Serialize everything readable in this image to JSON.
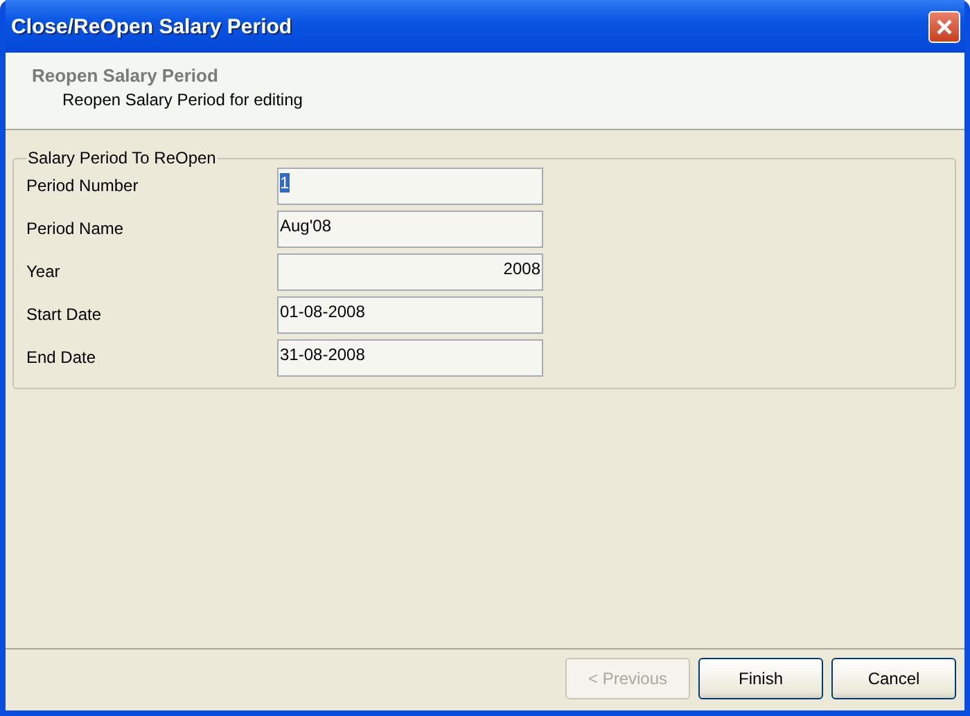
{
  "window": {
    "title": "Close/ReOpen Salary Period"
  },
  "header": {
    "title": "Reopen Salary Period",
    "subtitle": "Reopen Salary Period for editing"
  },
  "group": {
    "title": "Salary Period To ReOpen",
    "fields": [
      {
        "label": "Period Number",
        "value": "1",
        "kind": "text",
        "selected": true
      },
      {
        "label": "Period Name",
        "value": "Aug'08",
        "kind": "text",
        "selected": false
      },
      {
        "label": "Year",
        "value": "2008",
        "kind": "number",
        "selected": false
      },
      {
        "label": "Start Date",
        "value": "01-08-2008",
        "kind": "text",
        "selected": false
      },
      {
        "label": "End Date",
        "value": "31-08-2008",
        "kind": "text",
        "selected": false
      }
    ]
  },
  "buttons": [
    {
      "label": "< Previous",
      "disabled": true
    },
    {
      "label": "Finish",
      "disabled": false
    },
    {
      "label": "Cancel",
      "disabled": false
    }
  ]
}
